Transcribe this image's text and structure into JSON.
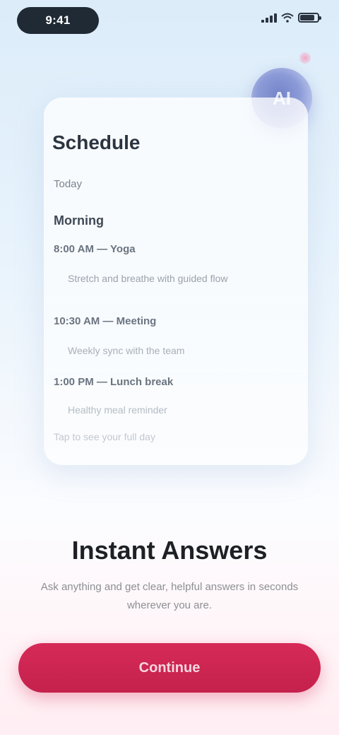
{
  "status_bar": {
    "time": "9:41",
    "icons": [
      "signal-icon",
      "wifi-icon",
      "battery-icon"
    ]
  },
  "avatar": {
    "initials": "AI"
  },
  "card": {
    "title": "Schedule",
    "line1": "Today",
    "line2": "Morning",
    "line3": "8:00 AM — Yoga",
    "line4": "Stretch and breathe with guided flow",
    "line5": "10:30 AM — Meeting",
    "line6": "Weekly sync with the team",
    "line7": "1:00 PM — Lunch break",
    "line8": "Healthy meal reminder",
    "line9": "Tap to see your full day"
  },
  "intro": {
    "headline": "Instant Answers",
    "subtext": "Ask anything and get clear, helpful answers in seconds wherever you are."
  },
  "cta": {
    "label": "Continue"
  },
  "colors": {
    "accent": "#d62a58",
    "background_top": "#dcecf9",
    "background_bottom": "#ffeef3"
  }
}
